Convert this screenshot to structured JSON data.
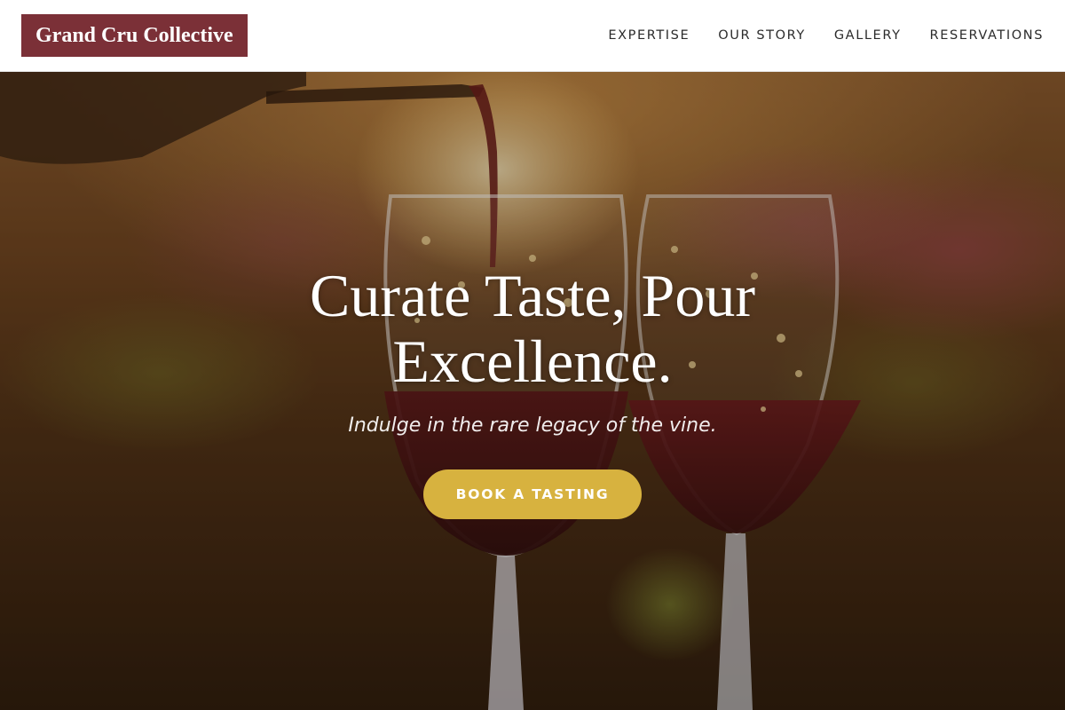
{
  "header": {
    "logo_text": "Grand Cru Collective",
    "nav": [
      {
        "label": "EXPERTISE"
      },
      {
        "label": "OUR STORY"
      },
      {
        "label": "GALLERY"
      },
      {
        "label": "RESERVATIONS"
      }
    ]
  },
  "hero": {
    "title_line1": "Curate Taste, Pour",
    "title_line2": "Excellence.",
    "subtitle": "Indulge in the rare legacy of the vine.",
    "cta_label": "BOOK A TASTING",
    "background_image": "wine-glasses-pour-photo"
  },
  "colors": {
    "brand": "#7b3037",
    "accent": "#d7b23f",
    "header_bg": "#ffffff",
    "nav_text": "#2b2b2b"
  }
}
